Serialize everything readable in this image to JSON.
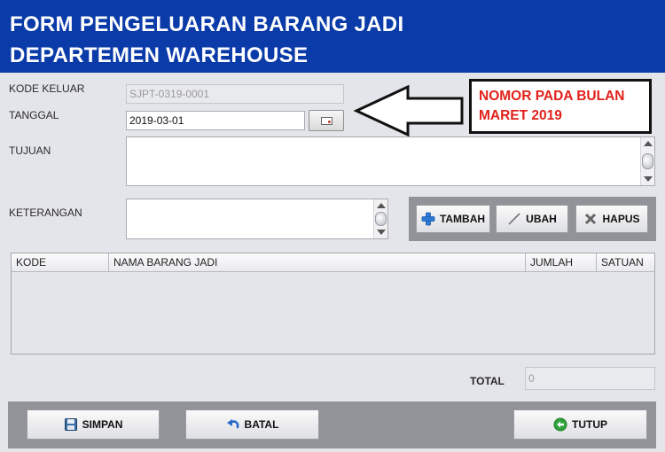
{
  "header": {
    "title_line1": "FORM PENGELUARAN BARANG JADI",
    "title_line2": "DEPARTEMEN WAREHOUSE"
  },
  "form": {
    "kode_keluar_label": "KODE KELUAR",
    "kode_keluar_value": "SJPT-0319-0001",
    "tanggal_label": "TANGGAL",
    "tanggal_value": "2019-03-01",
    "tujuan_label": "TUJUAN",
    "tujuan_value": "",
    "keterangan_label": "KETERANGAN",
    "keterangan_value": ""
  },
  "annotation": {
    "line1": "NOMOR PADA BULAN",
    "line2": "MARET 2019"
  },
  "item_buttons": {
    "tambah": "TAMBAH",
    "ubah": "UBAH",
    "hapus": "HAPUS"
  },
  "table": {
    "columns": [
      "KODE",
      "NAMA BARANG JADI",
      "JUMLAH",
      "SATUAN"
    ],
    "rows": []
  },
  "total": {
    "label": "TOTAL",
    "value": "0"
  },
  "footer_buttons": {
    "simpan": "SIMPAN",
    "batal": "BATAL",
    "tutup": "TUTUP"
  },
  "colors": {
    "header_bg": "#0a3ba8",
    "annotation_text": "#e1211a",
    "panel_bg": "#929399"
  },
  "icons": {
    "tambah": "plus-icon",
    "ubah": "pencil-icon",
    "hapus": "x-icon",
    "simpan": "floppy-disk-icon",
    "batal": "undo-icon",
    "tutup": "exit-icon",
    "tanggal": "calendar-icon"
  }
}
